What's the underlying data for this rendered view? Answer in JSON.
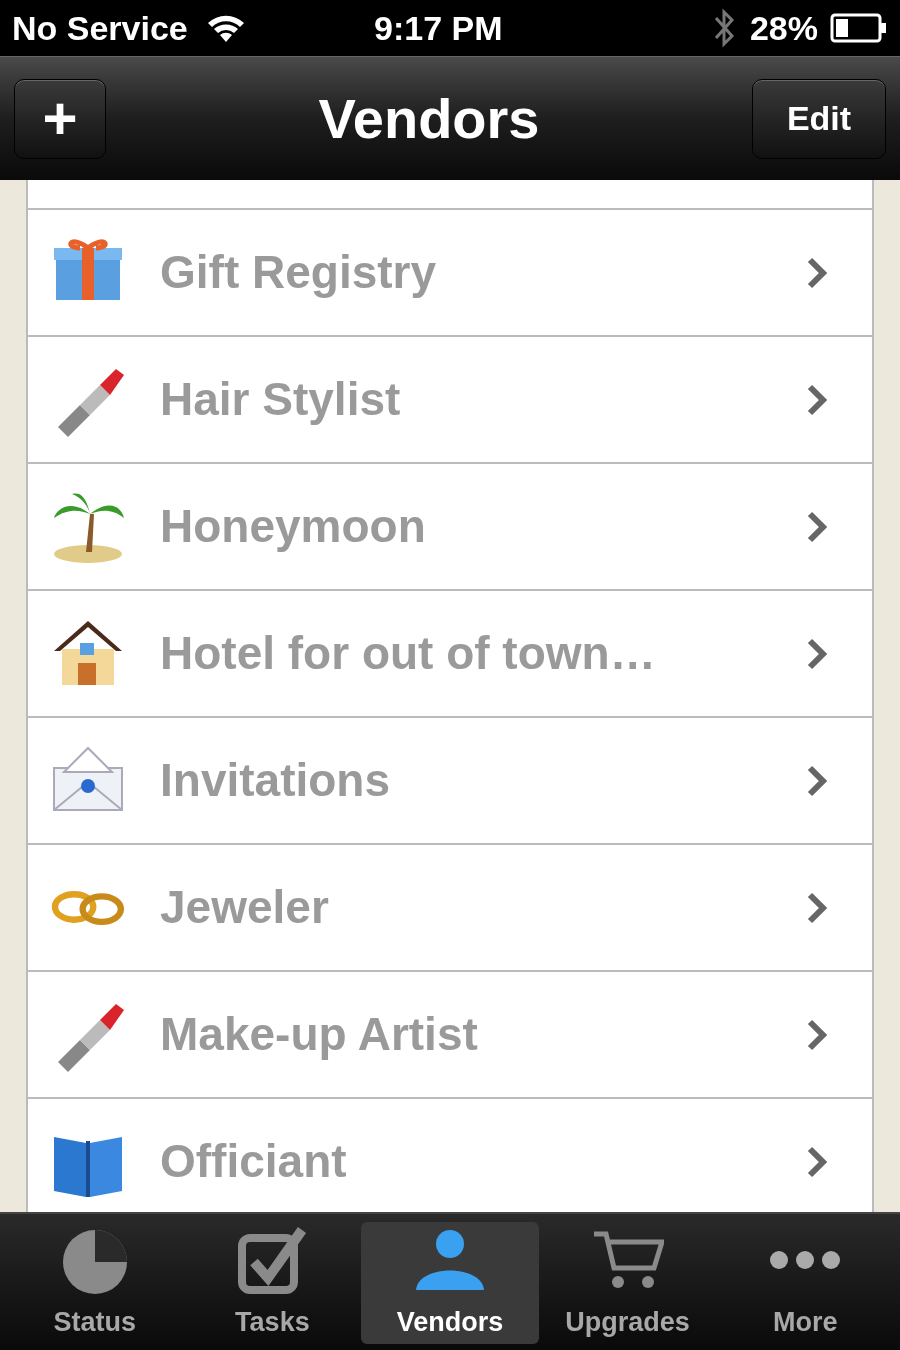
{
  "status_bar": {
    "carrier": "No Service",
    "time": "9:17 PM",
    "battery": "28%"
  },
  "nav_bar": {
    "add_button": "+",
    "title": "Vendors",
    "edit_button": "Edit"
  },
  "vendors": [
    {
      "name": "Gift Registry",
      "kind": "gift"
    },
    {
      "name": "Hair Stylist",
      "kind": "lipstick"
    },
    {
      "name": "Honeymoon",
      "kind": "palm"
    },
    {
      "name": "Hotel for out of town…",
      "kind": "house"
    },
    {
      "name": "Invitations",
      "kind": "envelope"
    },
    {
      "name": "Jeweler",
      "kind": "rings"
    },
    {
      "name": "Make-up Artist",
      "kind": "lipstick"
    },
    {
      "name": "Officiant",
      "kind": "book"
    }
  ],
  "tab_bar": [
    {
      "label": "Status",
      "kind": "pie",
      "selected": false
    },
    {
      "label": "Tasks",
      "kind": "check",
      "selected": false
    },
    {
      "label": "Vendors",
      "kind": "person",
      "selected": true
    },
    {
      "label": "Upgrades",
      "kind": "cart",
      "selected": false
    },
    {
      "label": "More",
      "kind": "dots",
      "selected": false
    }
  ]
}
